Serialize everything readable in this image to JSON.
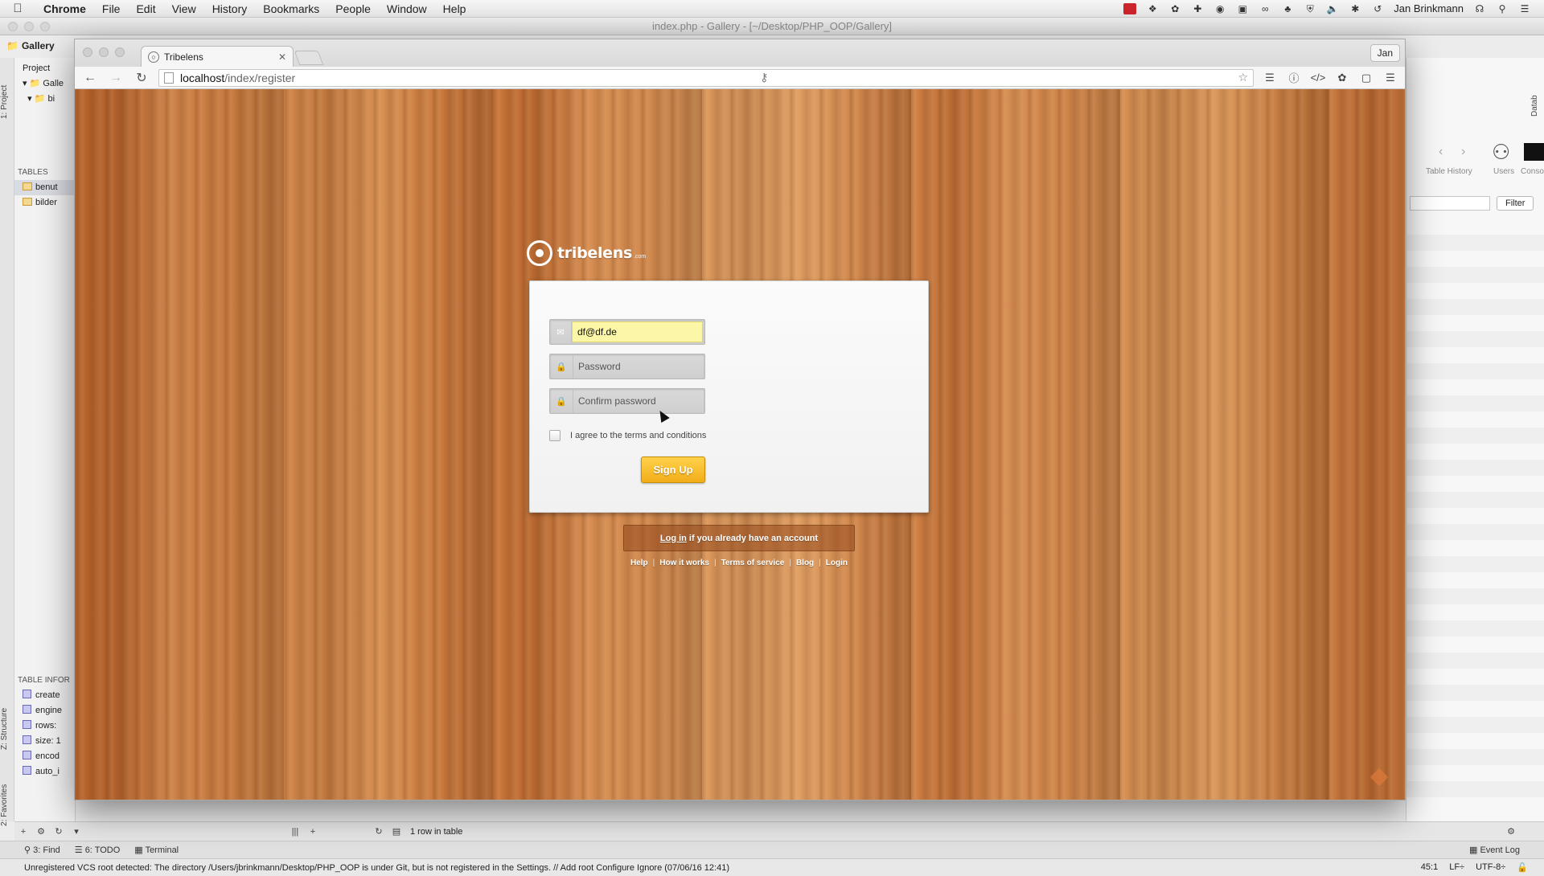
{
  "menubar": {
    "app_name": "Chrome",
    "items": [
      "File",
      "Edit",
      "View",
      "History",
      "Bookmarks",
      "People",
      "Window",
      "Help"
    ],
    "user_name": "Jan Brinkmann"
  },
  "ide": {
    "window_title": "index.php - Gallery - [~/Desktop/PHP_OOP/Gallery]",
    "breadcrumb_project": "Gallery",
    "project_tab": "Project",
    "tree_root": "Galle",
    "tree_child": "bi",
    "vertical_tab_project": "1: Project",
    "vertical_tab_structure": "Z: Structure",
    "vertical_tab_favorites": "2: Favorites",
    "vertical_tab_database": "Datab",
    "tables_header": "TABLES",
    "tables": [
      "benut",
      "bilder"
    ],
    "table_info_header": "TABLE INFOR",
    "table_info_items": [
      "create",
      "engine",
      "rows:",
      "size: 1",
      "encod",
      "auto_i"
    ],
    "right_toolbar": {
      "table_history": "Table History",
      "users": "Users",
      "console": "Conso"
    },
    "filter_button": "Filter",
    "rows_status": "1 row in table",
    "bottom_tabs": [
      "3: Find",
      "6: TODO",
      "Terminal"
    ],
    "event_log": "Event Log",
    "status_message": "Unregistered VCS root detected: The directory /Users/jbrinkmann/Desktop/PHP_OOP is under Git, but is not registered in the Settings. // Add root  Configure  Ignore (07/06/16 12:41)",
    "cursor_pos": "45:1",
    "line_sep": "LF÷",
    "encoding": "UTF-8÷"
  },
  "chrome": {
    "tab_title": "Tribelens",
    "profile_name": "Jan",
    "url_host": "localhost",
    "url_path": "/index/register"
  },
  "page": {
    "logo_text": "tribelens",
    "logo_suffix": ".com",
    "email_value": "df@df.de",
    "password_placeholder": "Password",
    "confirm_password_placeholder": "Confirm password",
    "agree_label": "I agree to the terms and conditions",
    "signup_button": "Sign Up",
    "login_link": "Log in",
    "login_text": "if you already have an account",
    "footer_links": [
      "Help",
      "How it works",
      "Terms of service",
      "Blog",
      "Login"
    ]
  }
}
